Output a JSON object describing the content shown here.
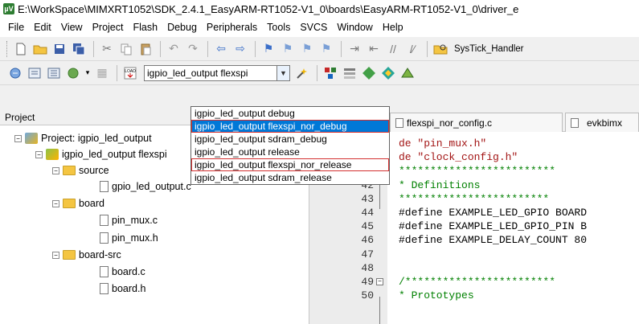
{
  "window": {
    "title": "E:\\WorkSpace\\MIMXRT1052\\SDK_2.4.1_EasyARM-RT1052-V1_0\\boards\\EasyARM-RT1052-V1_0\\driver_e",
    "app_icon": "µV"
  },
  "menu": [
    "File",
    "Edit",
    "View",
    "Project",
    "Flash",
    "Debug",
    "Peripherals",
    "Tools",
    "SVCS",
    "Window",
    "Help"
  ],
  "toolbar1": {
    "function_label": "SysTick_Handler"
  },
  "toolbar2": {
    "load_label": "LOAD",
    "target_select": {
      "value": "igpio_led_output flexspi"
    }
  },
  "dropdown": {
    "options": [
      "igpio_led_output debug",
      "igpio_led_output flexspi_nor_debug",
      "igpio_led_output sdram_debug",
      "igpio_led_output release",
      "igpio_led_output flexspi_nor_release",
      "igpio_led_output sdram_release"
    ]
  },
  "project_panel": {
    "header": "Project",
    "tree": [
      {
        "label": "Project: igpio_led_output",
        "expander": "−"
      },
      {
        "label": "igpio_led_output flexspi",
        "expander": "−"
      },
      {
        "label": "source",
        "expander": "−"
      },
      {
        "label": "gpio_led_output.c",
        "expander": ""
      },
      {
        "label": "board",
        "expander": "−"
      },
      {
        "label": "pin_mux.c",
        "expander": ""
      },
      {
        "label": "pin_mux.h",
        "expander": ""
      },
      {
        "label": "board-src",
        "expander": "−"
      },
      {
        "label": "board.c",
        "expander": ""
      },
      {
        "label": "board.h",
        "expander": ""
      }
    ]
  },
  "tabs": [
    {
      "label": "flexspi_nor_config.c"
    },
    {
      "label": "evkbimx"
    }
  ],
  "editor": {
    "lines": [
      {
        "num": "",
        "code": "de \"pin_mux.h\"",
        "kind": "string"
      },
      {
        "num": "",
        "code": "de \"clock_config.h\"",
        "kind": "string"
      },
      {
        "num": "",
        "code": "*************************",
        "kind": "comment"
      },
      {
        "num": "42",
        "code": " * Definitions",
        "kind": "comment"
      },
      {
        "num": "43",
        "code": " ************************",
        "kind": "comment"
      },
      {
        "num": "44",
        "code": "#define EXAMPLE_LED_GPIO BOARD",
        "kind": "macro"
      },
      {
        "num": "45",
        "code": "#define EXAMPLE_LED_GPIO_PIN B",
        "kind": "macro"
      },
      {
        "num": "46",
        "code": "#define EXAMPLE_DELAY_COUNT 80",
        "kind": "macro"
      },
      {
        "num": "47",
        "code": "",
        "kind": "plain"
      },
      {
        "num": "48",
        "code": "",
        "kind": "plain"
      },
      {
        "num": "49",
        "code": "/************************",
        "kind": "comment"
      },
      {
        "num": "50",
        "code": " * Prototypes",
        "kind": "comment"
      }
    ]
  },
  "colors": {
    "selection": "#0078d7",
    "highlight_box": "#d32f2f",
    "comment": "#008000",
    "string": "#a31515"
  }
}
